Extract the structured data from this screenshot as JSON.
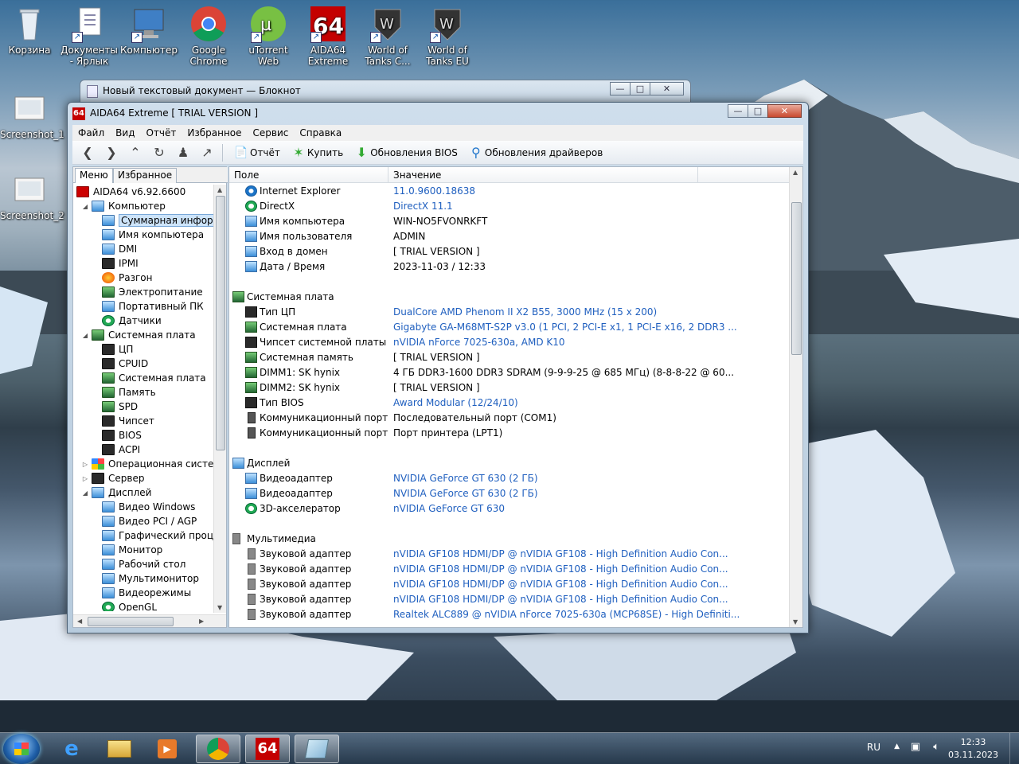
{
  "desktop": {
    "icons": [
      {
        "label": "Корзина",
        "icon": "recycle-bin-icon"
      },
      {
        "label": "Документы - Ярлык",
        "icon": "documents-shortcut-icon"
      },
      {
        "label": "Компьютер",
        "icon": "computer-icon"
      },
      {
        "label": "Google Chrome",
        "icon": "chrome-icon"
      },
      {
        "label": "uTorrent Web",
        "icon": "utorrent-icon"
      },
      {
        "label": "AIDA64 Extreme",
        "icon": "aida64-icon"
      },
      {
        "label": "World of Tanks C...",
        "icon": "wot-icon"
      },
      {
        "label": "World of Tanks EU",
        "icon": "wot-eu-icon"
      },
      {
        "label": "Screenshot_1",
        "icon": "screenshot-file-icon"
      },
      {
        "label": "Screenshot_2",
        "icon": "screenshot-file-icon"
      }
    ]
  },
  "notepad": {
    "title": "Новый текстовый документ — Блокнот"
  },
  "aida": {
    "logo": "64",
    "title": "AIDA64 Extreme  [ TRIAL VERSION ]",
    "menu": [
      "Файл",
      "Вид",
      "Отчёт",
      "Избранное",
      "Сервис",
      "Справка"
    ],
    "toolbar": {
      "report": "Отчёт",
      "buy": "Купить",
      "bios_updates": "Обновления BIOS",
      "driver_updates": "Обновления драйверов"
    },
    "tabs": {
      "menu": "Меню",
      "favorites": "Избранное"
    },
    "tree": [
      {
        "label": "AIDA64 v6.92.6600",
        "level": 0,
        "icon": "red"
      },
      {
        "label": "Компьютер",
        "level": 1,
        "exp": "◢",
        "icon": ""
      },
      {
        "label": "Суммарная инфор",
        "level": 2,
        "icon": "",
        "sel": true
      },
      {
        "label": "Имя компьютера",
        "level": 2,
        "icon": ""
      },
      {
        "label": "DMI",
        "level": 2,
        "icon": ""
      },
      {
        "label": "IPMI",
        "level": 2,
        "icon": "chip"
      },
      {
        "label": "Разгон",
        "level": 2,
        "icon": "fire"
      },
      {
        "label": "Электропитание",
        "level": 2,
        "icon": "green"
      },
      {
        "label": "Портативный ПК",
        "level": 2,
        "icon": ""
      },
      {
        "label": "Датчики",
        "level": 2,
        "icon": "gear"
      },
      {
        "label": "Системная плата",
        "level": 1,
        "exp": "◢",
        "icon": "green"
      },
      {
        "label": "ЦП",
        "level": 2,
        "icon": "chip"
      },
      {
        "label": "CPUID",
        "level": 2,
        "icon": "chip"
      },
      {
        "label": "Системная плата",
        "level": 2,
        "icon": "green"
      },
      {
        "label": "Память",
        "level": 2,
        "icon": "green"
      },
      {
        "label": "SPD",
        "level": 2,
        "icon": "green"
      },
      {
        "label": "Чипсет",
        "level": 2,
        "icon": "chip"
      },
      {
        "label": "BIOS",
        "level": 2,
        "icon": "chip"
      },
      {
        "label": "ACPI",
        "level": 2,
        "icon": "chip"
      },
      {
        "label": "Операционная систем",
        "level": 1,
        "exp": "▷",
        "icon": "win7"
      },
      {
        "label": "Сервер",
        "level": 1,
        "exp": "▷",
        "icon": "chip"
      },
      {
        "label": "Дисплей",
        "level": 1,
        "exp": "◢",
        "icon": ""
      },
      {
        "label": "Видео Windows",
        "level": 2,
        "icon": ""
      },
      {
        "label": "Видео PCI / AGP",
        "level": 2,
        "icon": ""
      },
      {
        "label": "Графический проц",
        "level": 2,
        "icon": ""
      },
      {
        "label": "Монитор",
        "level": 2,
        "icon": ""
      },
      {
        "label": "Рабочий стол",
        "level": 2,
        "icon": ""
      },
      {
        "label": "Мультимонитор",
        "level": 2,
        "icon": ""
      },
      {
        "label": "Видеорежимы",
        "level": 2,
        "icon": ""
      },
      {
        "label": "OpenGL",
        "level": 2,
        "icon": "gear"
      }
    ],
    "columns": {
      "field": "Поле",
      "value": "Значение"
    },
    "rows": [
      {
        "f": "Internet Explorer",
        "v": "11.0.9600.18638",
        "link": true,
        "icon": "ie"
      },
      {
        "f": "DirectX",
        "v": "DirectX 11.1",
        "link": true,
        "icon": "xbox"
      },
      {
        "f": "Имя компьютера",
        "v": "WIN-NO5FVONRKFT",
        "icon": ""
      },
      {
        "f": "Имя пользователя",
        "v": "ADMIN",
        "icon": ""
      },
      {
        "f": "Вход в домен",
        "v": "[ TRIAL VERSION ]",
        "icon": ""
      },
      {
        "f": "Дата / Время",
        "v": "2023-11-03 / 12:33",
        "icon": ""
      },
      {
        "f": "",
        "v": "",
        "icon": "none"
      },
      {
        "f": "Системная плата",
        "v": "",
        "group": true,
        "icon": "green"
      },
      {
        "f": "Тип ЦП",
        "v": "DualCore AMD Phenom II X2 B55, 3000 MHz (15 x 200)",
        "link": true,
        "icon": "chip"
      },
      {
        "f": "Системная плата",
        "v": "Gigabyte GA-M68MT-S2P v3.0  (1 PCI, 2 PCI-E x1, 1 PCI-E x16, 2 DDR3 ...",
        "link": true,
        "icon": "green"
      },
      {
        "f": "Чипсет системной платы",
        "v": "nVIDIA nForce 7025-630a, AMD K10",
        "link": true,
        "icon": "chip"
      },
      {
        "f": "Системная память",
        "v": "[ TRIAL VERSION ]",
        "icon": "green"
      },
      {
        "f": "DIMM1: SK hynix",
        "v": "4 ГБ DDR3-1600 DDR3 SDRAM  (9-9-9-25 @ 685 МГц)  (8-8-8-22 @ 60...",
        "icon": "green"
      },
      {
        "f": "DIMM2: SK hynix",
        "v": "[ TRIAL VERSION ]",
        "icon": "green"
      },
      {
        "f": "Тип BIOS",
        "v": "Award Modular (12/24/10)",
        "link": true,
        "icon": "chip"
      },
      {
        "f": "Коммуникационный порт",
        "v": "Последовательный порт (COM1)",
        "icon": "port"
      },
      {
        "f": "Коммуникационный порт",
        "v": "Порт принтера (LPT1)",
        "icon": "port"
      },
      {
        "f": "",
        "v": "",
        "icon": "none"
      },
      {
        "f": "Дисплей",
        "v": "",
        "group": true,
        "icon": ""
      },
      {
        "f": "Видеоадаптер",
        "v": "NVIDIA GeForce GT 630  (2 ГБ)",
        "link": true,
        "icon": ""
      },
      {
        "f": "Видеоадаптер",
        "v": "NVIDIA GeForce GT 630  (2 ГБ)",
        "link": true,
        "icon": ""
      },
      {
        "f": "3D-акселератор",
        "v": "nVIDIA GeForce GT 630",
        "link": true,
        "icon": "xbox"
      },
      {
        "f": "",
        "v": "",
        "icon": "none"
      },
      {
        "f": "Мультимедиа",
        "v": "",
        "group": true,
        "icon": "spk"
      },
      {
        "f": "Звуковой адаптер",
        "v": "nVIDIA GF108 HDMI/DP @ nVIDIA GF108 - High Definition Audio Con...",
        "link": true,
        "icon": "spk"
      },
      {
        "f": "Звуковой адаптер",
        "v": "nVIDIA GF108 HDMI/DP @ nVIDIA GF108 - High Definition Audio Con...",
        "link": true,
        "icon": "spk"
      },
      {
        "f": "Звуковой адаптер",
        "v": "nVIDIA GF108 HDMI/DP @ nVIDIA GF108 - High Definition Audio Con...",
        "link": true,
        "icon": "spk"
      },
      {
        "f": "Звуковой адаптер",
        "v": "nVIDIA GF108 HDMI/DP @ nVIDIA GF108 - High Definition Audio Con...",
        "link": true,
        "icon": "spk"
      },
      {
        "f": "Звуковой адаптер",
        "v": "Realtek ALC889 @ nVIDIA nForce 7025-630a (MCP68SE) - High Definiti...",
        "link": true,
        "icon": "spk"
      }
    ]
  },
  "taskbar": {
    "lang": "RU",
    "time": "12:33",
    "date": "03.11.2023",
    "buttons": [
      "ie-icon",
      "explorer-icon",
      "media-player-icon",
      "chrome-icon",
      "aida64-icon",
      "notepad-icon"
    ]
  }
}
